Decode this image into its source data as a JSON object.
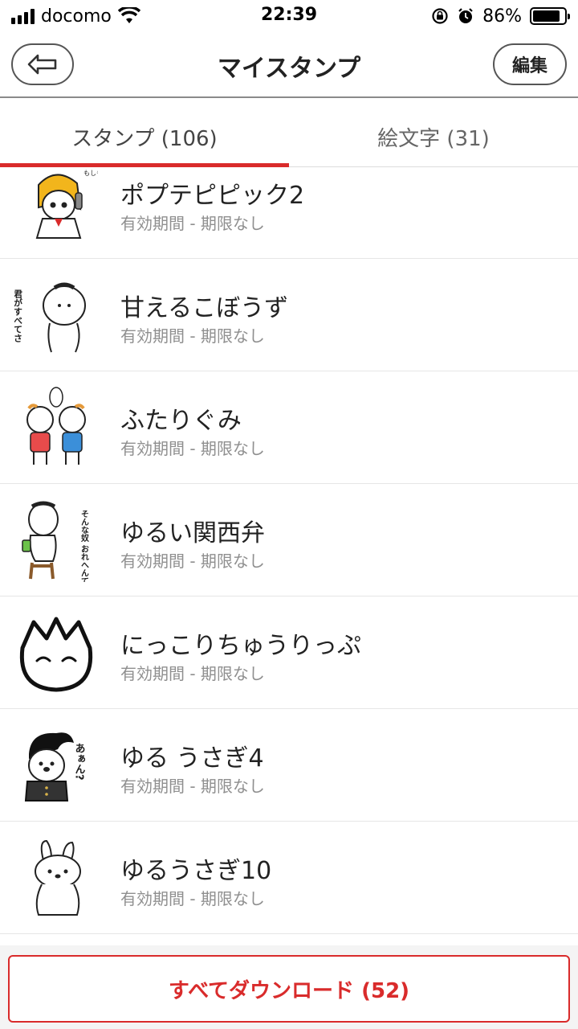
{
  "status_bar": {
    "carrier": "docomo",
    "time": "22:39",
    "battery_percent": "86%",
    "battery_level": 0.86,
    "signal_icon": "signal-bars-icon",
    "wifi_icon": "wifi-icon",
    "rotation_lock_icon": "rotation-lock-icon",
    "alarm_icon": "alarm-icon"
  },
  "nav": {
    "title": "マイスタンプ",
    "back_icon": "back-arrow-icon",
    "edit_label": "編集"
  },
  "tabs": [
    {
      "label": "スタンプ (106)",
      "active": true
    },
    {
      "label": "絵文字 (31)",
      "active": false
    }
  ],
  "stickers": [
    {
      "title": "ポプテピピック2",
      "subtitle": "有効期間 - 期限なし",
      "thumb_icon": "sticker-thumbnail-icon",
      "thumb_text": "もしもし"
    },
    {
      "title": "甘えるこぼうず",
      "subtitle": "有効期間 - 期限なし",
      "thumb_icon": "sticker-thumbnail-icon",
      "thumb_text": "君がすべてさ"
    },
    {
      "title": "ふたりぐみ",
      "subtitle": "有効期間 - 期限なし",
      "thumb_icon": "sticker-thumbnail-icon",
      "thumb_text": ""
    },
    {
      "title": "ゆるい関西弁",
      "subtitle": "有効期間 - 期限なし",
      "thumb_icon": "sticker-thumbnail-icon",
      "thumb_text": "そんな奴 おれへんて"
    },
    {
      "title": "にっこりちゅうりっぷ",
      "subtitle": "有効期間 - 期限なし",
      "thumb_icon": "sticker-thumbnail-icon",
      "thumb_text": ""
    },
    {
      "title": "ゆる うさぎ4",
      "subtitle": "有効期間 - 期限なし",
      "thumb_icon": "sticker-thumbnail-icon",
      "thumb_text": "あぁん?"
    },
    {
      "title": "ゆるうさぎ10",
      "subtitle": "有効期間 - 期限なし",
      "thumb_icon": "sticker-thumbnail-icon",
      "thumb_text": ""
    }
  ],
  "bottom": {
    "download_label": "すべてダウンロード (52)"
  },
  "colors": {
    "accent": "#d92b2b",
    "subtitle": "#8f8f8f",
    "divider": "#e6e6e6"
  }
}
